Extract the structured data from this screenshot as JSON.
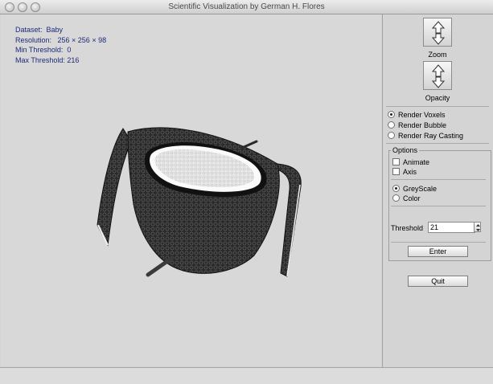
{
  "window": {
    "title": "Scientific Visualization by German H. Flores"
  },
  "info": {
    "dataset": "Dataset:  Baby",
    "resolution": "Resolution:   256 × 256 × 98",
    "min_threshold": "Min Threshold:  0",
    "max_threshold": "Max Threshold: 216"
  },
  "controls": {
    "zoom_label": "Zoom",
    "opacity_label": "Opacity",
    "render_modes": [
      {
        "label": "Render Voxels",
        "selected": true
      },
      {
        "label": "Render Bubble",
        "selected": false
      },
      {
        "label": "Render Ray Casting",
        "selected": false
      }
    ],
    "options_title": "Options",
    "animate_label": "Animate",
    "axis_label": "Axis",
    "color_modes": [
      {
        "label": "GreyScale",
        "selected": true
      },
      {
        "label": "Color",
        "selected": false
      }
    ],
    "threshold_label": "Threshold",
    "threshold_value": "21",
    "enter_label": "Enter",
    "quit_label": "Quit"
  },
  "icons": [
    "close-icon",
    "minimize-icon",
    "zoom-window-icon",
    "arrow-up-down-icon",
    "stepper-icon"
  ]
}
